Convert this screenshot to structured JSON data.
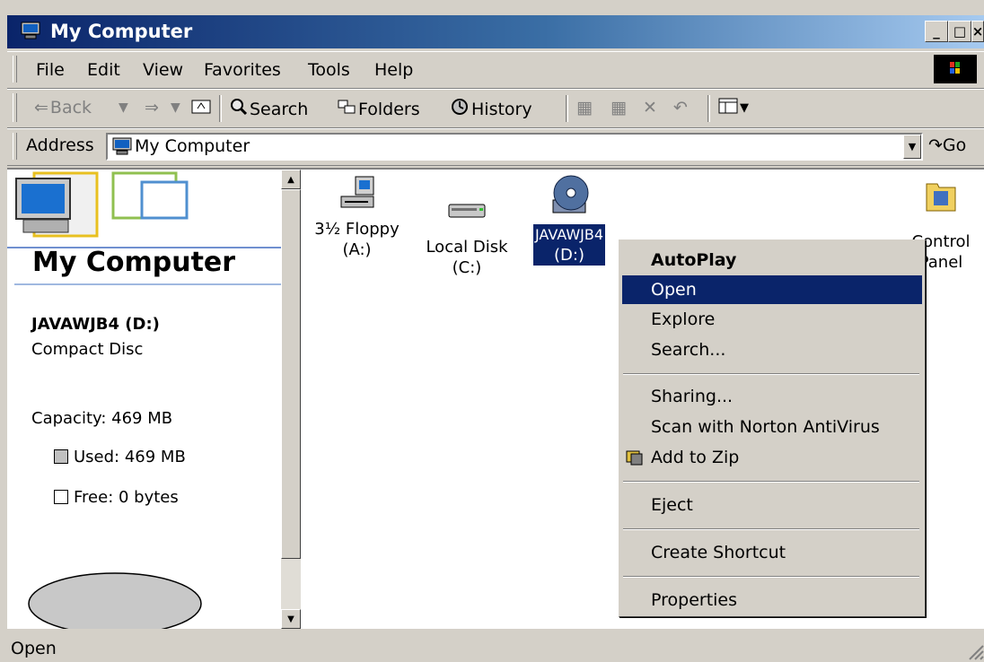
{
  "window": {
    "title": "My Computer",
    "caption_buttons": [
      "_",
      "□",
      "×"
    ]
  },
  "menu": [
    "File",
    "Edit",
    "View",
    "Favorites",
    "Tools",
    "Help"
  ],
  "toolbar": {
    "back": "Back",
    "search": "Search",
    "folders": "Folders",
    "history": "History"
  },
  "address": {
    "label": "Address",
    "value": "My Computer",
    "go": "Go"
  },
  "left_panel": {
    "heading": "My Computer",
    "selected_name": "JAVAWJB4 (D:)",
    "selected_type": "Compact Disc",
    "capacity": "Capacity: 469 MB",
    "used": "Used: 469 MB",
    "free": "Free: 0 bytes"
  },
  "drives": [
    {
      "name": "3½ Floppy",
      "letter": "(A:)",
      "icon": "floppy-drive-icon"
    },
    {
      "name": "Local Disk",
      "letter": "(C:)",
      "icon": "hard-disk-icon"
    },
    {
      "name": "JAVAWJB4",
      "letter": "(D:)",
      "icon": "cd-drive-icon",
      "selected": true
    },
    {
      "name": "Control",
      "letter": "Panel",
      "icon": "control-panel-icon"
    }
  ],
  "context_menu": {
    "items": [
      "AutoPlay",
      "Open",
      "Explore",
      "Search...",
      "Sharing...",
      "Scan with Norton AntiVirus",
      "Add to Zip",
      "Eject",
      "Create Shortcut",
      "Properties"
    ],
    "default_item": "AutoPlay",
    "highlighted_item": "Open"
  },
  "status": "Open",
  "colors": {
    "titlebar": "#0a246a",
    "selection": "#0a246a",
    "face": "#d4d0c8"
  }
}
